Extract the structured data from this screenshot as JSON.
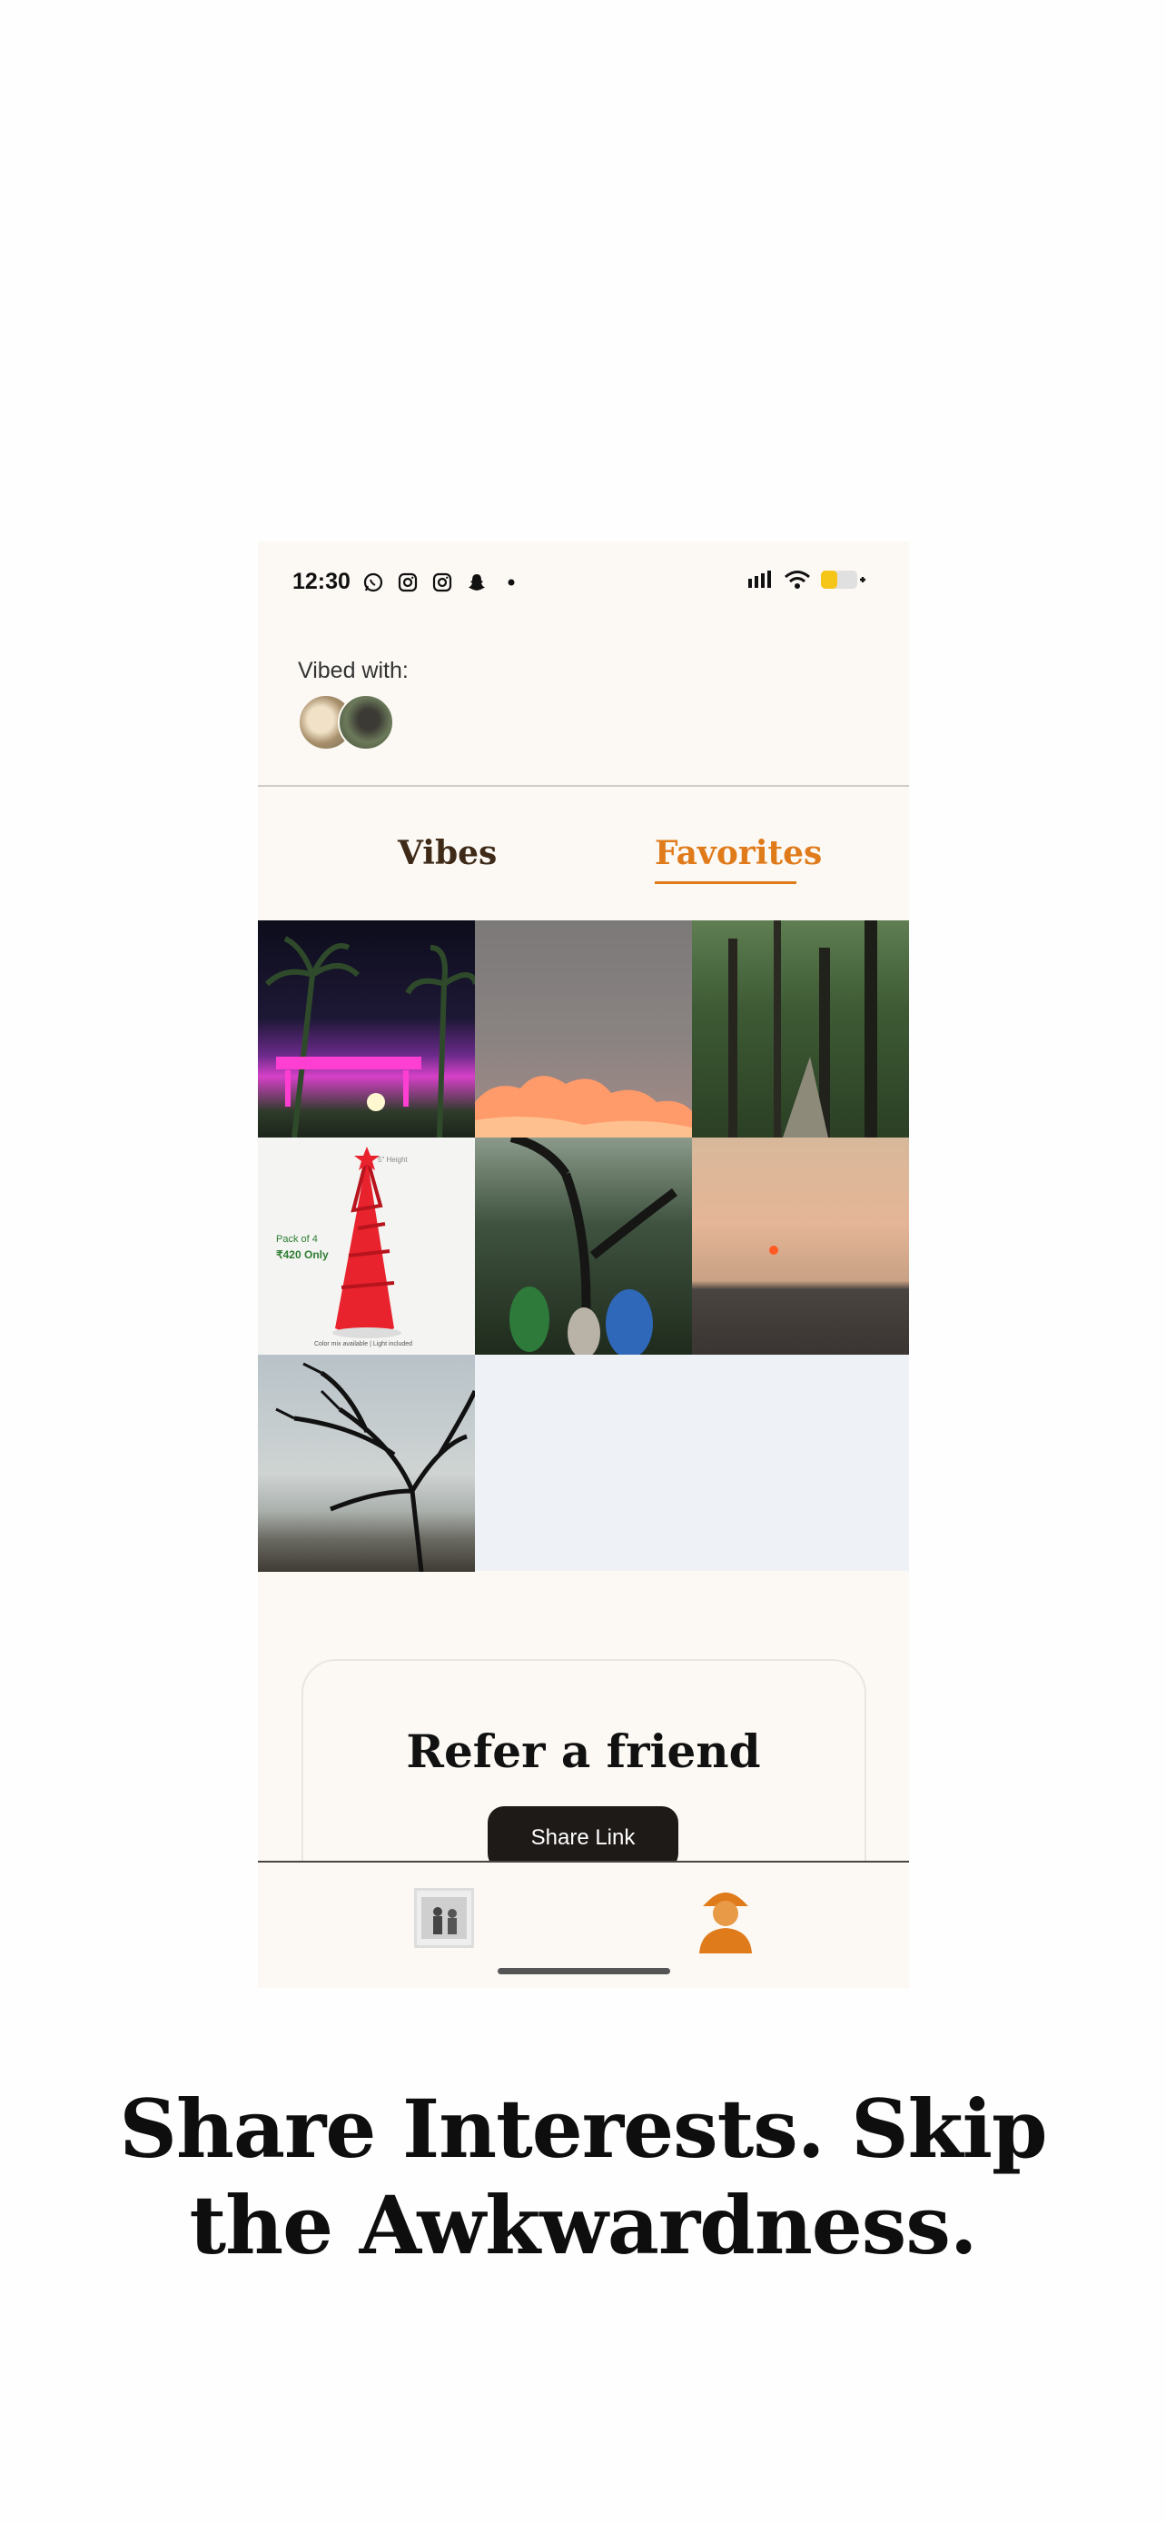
{
  "status_bar": {
    "time": "12:30",
    "left_icons": [
      "whatsapp-icon",
      "instagram-icon",
      "instagram-icon",
      "snapchat-icon",
      "dot-icon"
    ],
    "right_icons": [
      "signal-icon",
      "wifi-icon",
      "battery-icon"
    ],
    "battery_color": "#f5c518"
  },
  "profile": {
    "vibed_with_label": "Vibed with:",
    "avatars": [
      "avatar-1",
      "avatar-2"
    ]
  },
  "tabs": [
    {
      "label": "Vibes",
      "active": false
    },
    {
      "label": "Favorites",
      "active": true
    }
  ],
  "accent_color": "#e07b1c",
  "gallery": {
    "tiles": [
      {
        "name": "night-lights-tile"
      },
      {
        "name": "sunset-cloud-tile"
      },
      {
        "name": "forest-path-tile"
      },
      {
        "name": "red-tree-product-tile",
        "overlay_text": [
          "Pack of 4",
          "₹420 Only"
        ],
        "height_text": "5\" Height",
        "footer_text": "Color mix available | Light included"
      },
      {
        "name": "forest-hikers-tile"
      },
      {
        "name": "beach-sunset-tile"
      },
      {
        "name": "silhouette-tree-tile"
      }
    ]
  },
  "refer": {
    "title": "Refer a friend",
    "button_label": "Share Link"
  },
  "bottom_nav": {
    "items": [
      "home-icon",
      "profile-icon"
    ]
  },
  "headline": {
    "line1": "Share Interests. Skip",
    "line2": "the Awkwardness."
  }
}
